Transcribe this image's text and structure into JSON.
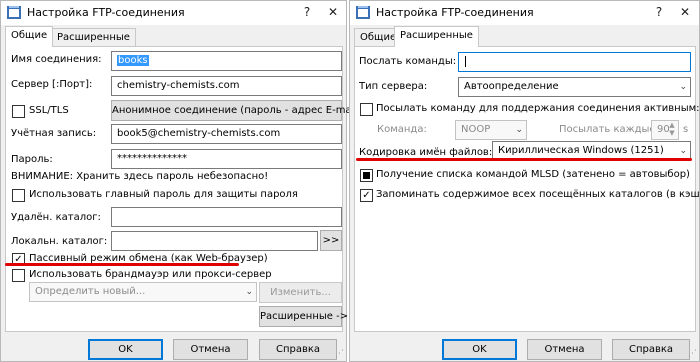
{
  "left": {
    "title": "Настройка FTP-соединения",
    "tabs": [
      "Общие",
      "Расширенные"
    ],
    "host_name_label": "Имя соединения:",
    "host_name_value": "books",
    "server_label": "Сервер [:Порт]:",
    "server_value": "chemistry-chemists.com",
    "ssl_label": "SSL/TLS",
    "anonymous_button": "Анонимное соединение (пароль - адрес E-mail)",
    "account_label": "Учётная запись:",
    "account_value": "book5@chemistry-chemists.com",
    "password_label": "Пароль:",
    "password_value": "**************",
    "warning_text": "ВНИМАНИЕ: Хранить здесь пароль небезопасно!",
    "master_password_label": "Использовать главный пароль для защиты пароля",
    "remote_dir_label": "Удалён. каталог:",
    "remote_dir_value": "",
    "local_dir_label": "Локальн. каталог:",
    "local_dir_value": "",
    "browse_button": ">>",
    "passive_label": "Пассивный режим обмена (как Web-браузер)",
    "firewall_label": "Использовать брандмауэр или прокси-сервер",
    "firewall_select": "Определить новый...",
    "change_button": "Изменить...",
    "advanced_button": "Расширенные ->",
    "ok_button": "OK",
    "cancel_button": "Отмена",
    "help_button": "Справка"
  },
  "right": {
    "title": "Настройка FTP-соединения",
    "tabs": [
      "Общие",
      "Расширенные"
    ],
    "send_command_label": "Послать команды:",
    "send_command_value": "",
    "server_type_label": "Тип сервера:",
    "server_type_value": "Автоопределение",
    "keepalive_label": "Посылать команду для поддержания соединения активным:",
    "command_label": "Команда:",
    "command_value": "NOOP",
    "interval_label": "Посылать каждые:",
    "interval_value": "90",
    "interval_unit": "s",
    "encoding_label": "Кодировка имён файлов:",
    "encoding_value": "Кириллическая Windows (1251)",
    "mlsd_label": "Получение списка командой MLSD (затенено = автовыбор)",
    "cache_label": "Запоминать содержимое всех посещённых каталогов (в кэше)",
    "ok_button": "OK",
    "cancel_button": "Отмена",
    "help_button": "Справка"
  },
  "colors": {
    "annotation": "#e00000",
    "focus": "#0078d7",
    "selection": "#3399ff"
  }
}
